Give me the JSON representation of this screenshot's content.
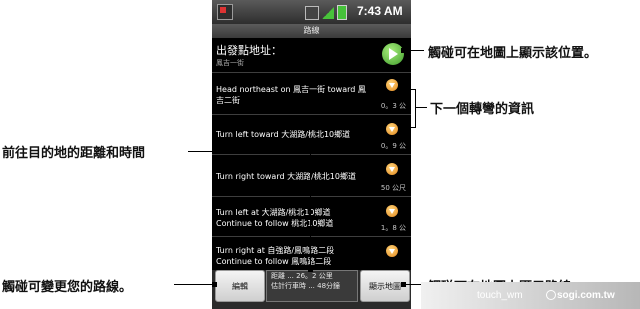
{
  "status_bar": {
    "time": "7:43 AM"
  },
  "screen_title": "路線",
  "start": {
    "label": "出發點地址：",
    "value": "鳳吉一街"
  },
  "steps": [
    {
      "line1": "Head northeast on 鳳吉一街 toward 鳳",
      "line2": "吉二街",
      "distance": "0。3 公"
    },
    {
      "line1": "Turn left toward 大湖路/桃北10鄉道",
      "line2": "",
      "distance": "0。9 公"
    },
    {
      "line1": "Turn right toward 大湖路/桃北10鄉道",
      "line2": "",
      "distance": "50 公尺"
    },
    {
      "line1": "Turn left at 大湖路/桃北10鄉道",
      "line2": "Continue to follow 桃北10鄉道",
      "distance": "1。8 公"
    },
    {
      "line1": "Turn right at 自強路/鳳鳴路二段",
      "line2": "Continue to follow 鳳鳴路二段",
      "distance": ""
    }
  ],
  "buttons": {
    "edit": "編輯",
    "show_map": "顯示地圖"
  },
  "summary": {
    "distance": "距離 ... 26。2 公里",
    "time": "估計行車時 ... 48分鐘"
  },
  "annotations": {
    "show_position": "觸碰可在地圖上顯示該位置。",
    "next_turn_info": "下一個轉彎的資訊",
    "distance_time": "前往目的地的距離和時間",
    "change_route": "觸碰可變更您的路線。",
    "show_route": "觸碰可在地圖上顯示路線。"
  },
  "watermark": {
    "left": "touch_wm",
    "right": "sogi.com.tw"
  }
}
